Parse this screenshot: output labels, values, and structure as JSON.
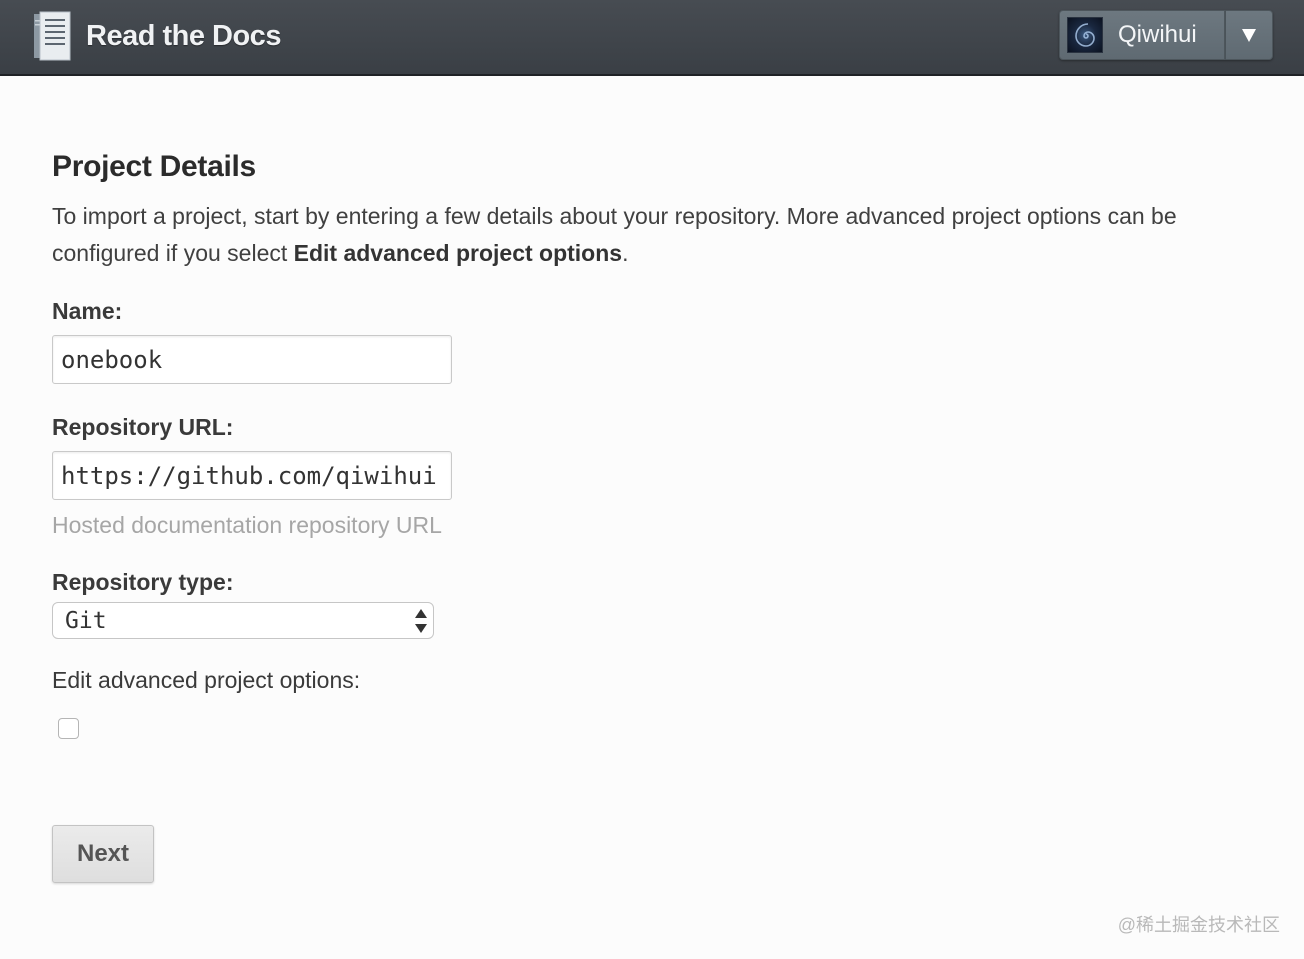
{
  "header": {
    "brand": "Read the Docs",
    "logo_icon": "book-icon",
    "user": {
      "name": "Qiwihui",
      "avatar_icon": "spiral-avatar-icon",
      "menu_icon": "caret-down-icon"
    }
  },
  "page": {
    "title": "Project Details",
    "intro_text": "To import a project, start by entering a few details about your repository. More advanced project options can be configured if you select ",
    "intro_bold": "Edit advanced project options",
    "intro_end": "."
  },
  "form": {
    "name": {
      "label": "Name:",
      "value": "onebook"
    },
    "repo_url": {
      "label": "Repository URL:",
      "value": "https://github.com/qiwihui",
      "help": "Hosted documentation repository URL"
    },
    "repo_type": {
      "label": "Repository type:",
      "selected": "Git"
    },
    "advanced": {
      "label": "Edit advanced project options:",
      "checked": false
    },
    "submit_label": "Next"
  },
  "watermark": "@稀土掘金技术社区"
}
